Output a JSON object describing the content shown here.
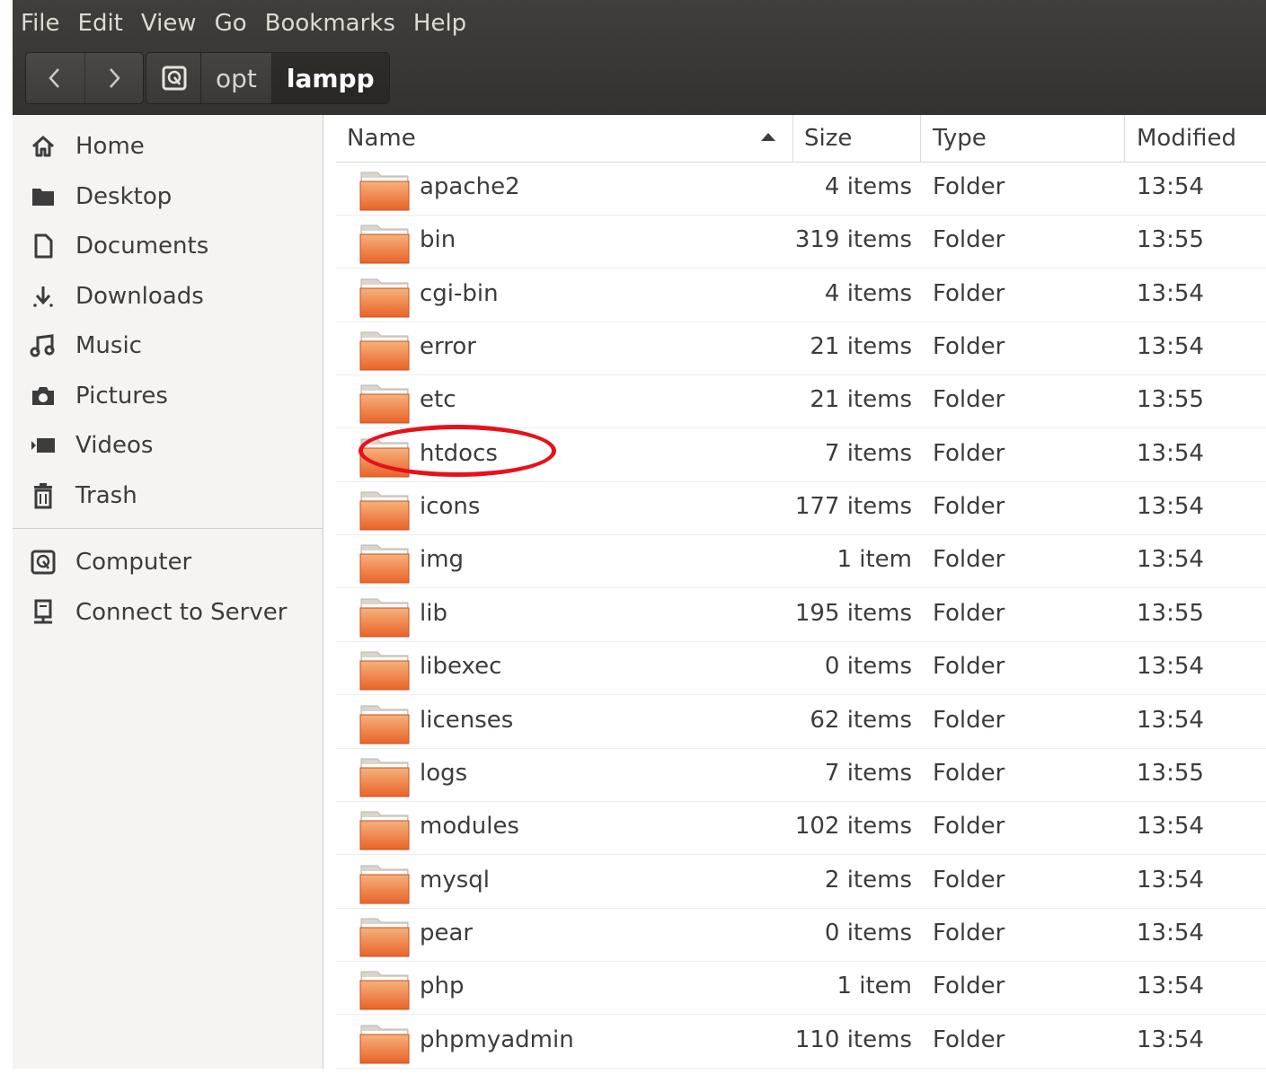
{
  "menubar": {
    "items": [
      "File",
      "Edit",
      "View",
      "Go",
      "Bookmarks",
      "Help"
    ]
  },
  "toolbar": {
    "back_icon": "chevron-left-icon",
    "forward_icon": "chevron-right-icon",
    "path_root_icon": "drive-icon",
    "path": [
      "opt",
      "lampp"
    ]
  },
  "sidebar": {
    "items": [
      {
        "label": "Home",
        "icon": "home-icon"
      },
      {
        "label": "Desktop",
        "icon": "desktop-icon"
      },
      {
        "label": "Documents",
        "icon": "document-icon"
      },
      {
        "label": "Downloads",
        "icon": "download-icon"
      },
      {
        "label": "Music",
        "icon": "music-icon"
      },
      {
        "label": "Pictures",
        "icon": "camera-icon"
      },
      {
        "label": "Videos",
        "icon": "video-icon"
      },
      {
        "label": "Trash",
        "icon": "trash-icon"
      }
    ],
    "devices": [
      {
        "label": "Computer",
        "icon": "drive-icon"
      },
      {
        "label": "Connect to Server",
        "icon": "server-icon"
      }
    ]
  },
  "filelist": {
    "columns": {
      "name": "Name",
      "size": "Size",
      "type": "Type",
      "modified": "Modified"
    },
    "sort": "Name ascending",
    "rows": [
      {
        "name": "apache2",
        "size": "4 items",
        "type": "Folder",
        "modified": "13:54"
      },
      {
        "name": "bin",
        "size": "319 items",
        "type": "Folder",
        "modified": "13:55"
      },
      {
        "name": "cgi-bin",
        "size": "4 items",
        "type": "Folder",
        "modified": "13:54"
      },
      {
        "name": "error",
        "size": "21 items",
        "type": "Folder",
        "modified": "13:54"
      },
      {
        "name": "etc",
        "size": "21 items",
        "type": "Folder",
        "modified": "13:55"
      },
      {
        "name": "htdocs",
        "size": "7 items",
        "type": "Folder",
        "modified": "13:54"
      },
      {
        "name": "icons",
        "size": "177 items",
        "type": "Folder",
        "modified": "13:54"
      },
      {
        "name": "img",
        "size": "1 item",
        "type": "Folder",
        "modified": "13:54"
      },
      {
        "name": "lib",
        "size": "195 items",
        "type": "Folder",
        "modified": "13:55"
      },
      {
        "name": "libexec",
        "size": "0 items",
        "type": "Folder",
        "modified": "13:54"
      },
      {
        "name": "licenses",
        "size": "62 items",
        "type": "Folder",
        "modified": "13:54"
      },
      {
        "name": "logs",
        "size": "7 items",
        "type": "Folder",
        "modified": "13:55"
      },
      {
        "name": "modules",
        "size": "102 items",
        "type": "Folder",
        "modified": "13:54"
      },
      {
        "name": "mysql",
        "size": "2 items",
        "type": "Folder",
        "modified": "13:54"
      },
      {
        "name": "pear",
        "size": "0 items",
        "type": "Folder",
        "modified": "13:54"
      },
      {
        "name": "php",
        "size": "1 item",
        "type": "Folder",
        "modified": "13:54"
      },
      {
        "name": "phpmyadmin",
        "size": "110 items",
        "type": "Folder",
        "modified": "13:54"
      }
    ]
  },
  "annotation": {
    "highlighted_item": "htdocs",
    "color": "#e8101b"
  },
  "colors": {
    "folder_orange": "#e9632a",
    "folder_light": "#f6b27a"
  }
}
